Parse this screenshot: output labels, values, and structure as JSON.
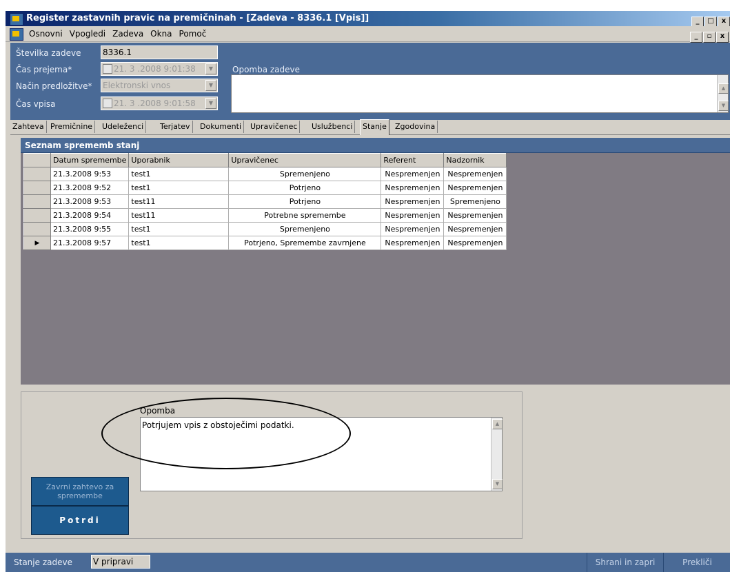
{
  "window": {
    "title": "Register zastavnih pravic na premičninah - [Zadeva - 8336.1 [Vpis]]"
  },
  "menu": {
    "items": [
      "Osnovni",
      "Vpogledi",
      "Zadeva",
      "Okna",
      "Pomoč"
    ]
  },
  "header": {
    "case_number_label": "Številka zadeve",
    "case_number_value": "8336.1",
    "received_time_label": "Čas prejema*",
    "received_time_value": "21. 3 .2008  9:01:38",
    "submission_method_label": "Način predložitve*",
    "submission_method_value": "Elektronski vnos",
    "entry_time_label": "Čas vpisa",
    "entry_time_value": "21. 3 .2008  9:01:58",
    "case_note_label": "Opomba zadeve"
  },
  "tabs": [
    "Zahteva",
    "Premičnine",
    "Udeleženci",
    "Terjatev",
    "Dokumenti",
    "Upravičenec",
    "Uslužbenci",
    "Stanje",
    "Zgodovina"
  ],
  "active_tab": "Stanje",
  "grid": {
    "title": "Seznam sprememb stanj",
    "columns": [
      "Datum spremembe",
      "Uporabnik",
      "Upravičenec",
      "Referent",
      "Nadzornik"
    ],
    "rows": [
      [
        "21.3.2008 9:53",
        "test1",
        "Spremenjeno",
        "Nespremenjen",
        "Nespremenjen"
      ],
      [
        "21.3.2008 9:52",
        "test1",
        "Potrjeno",
        "Nespremenjen",
        "Nespremenjen"
      ],
      [
        "21.3.2008 9:53",
        "test11",
        "Potrjeno",
        "Nespremenjen",
        "Spremenjeno"
      ],
      [
        "21.3.2008 9:54",
        "test11",
        "Potrebne spremembe",
        "Nespremenjen",
        "Nespremenjen"
      ],
      [
        "21.3.2008 9:55",
        "test1",
        "Spremenjeno",
        "Nespremenjen",
        "Nespremenjen"
      ],
      [
        "21.3.2008 9:57",
        "test1",
        "Potrjeno, Spremembe zavrnjene",
        "Nespremenjen",
        "Nespremenjen"
      ]
    ],
    "current_row_index": 5
  },
  "note": {
    "label": "Opomba",
    "value": "Potrjujem vpis z obstoječimi podatki."
  },
  "buttons": {
    "reject_label": "Zavrni zahtevo za spremembe",
    "confirm_label": "Potrdi",
    "save_close_label": "Shrani in zapri",
    "cancel_label": "Prekliči"
  },
  "status": {
    "label": "Stanje zadeve",
    "value": "V pripravi"
  },
  "colors": {
    "header_blue": "#4a6a96",
    "button_blue": "#1d5a8e",
    "panel_gray": "#807b83"
  }
}
